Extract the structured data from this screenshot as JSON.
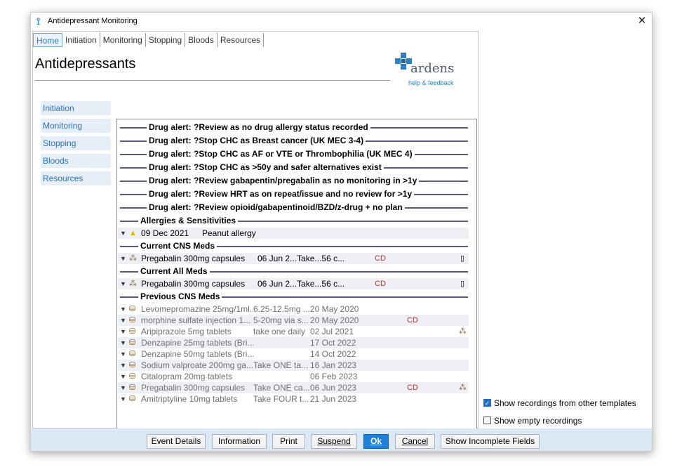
{
  "window": {
    "title": "Antidepressant Monitoring",
    "close_glyph": "✕"
  },
  "tabs": [
    "Home",
    "Initiation",
    "Monitoring",
    "Stopping",
    "Bloods",
    "Resources"
  ],
  "page_title": "Antidepressants",
  "logo": {
    "name": "ardens",
    "help": "help & feedback"
  },
  "sidebar": [
    "Initiation",
    "Monitoring",
    "Stopping",
    "Bloods",
    "Resources"
  ],
  "alerts": [
    "Drug alert: ?Review as no drug allergy status recorded",
    "Drug alert: ?Stop CHC as Breast cancer (UK MEC 3-4)",
    "Drug alert: ?Stop CHC as AF or VTE or Thrombophilia (UK MEC 4)",
    "Drug alert: ?Stop CHC as >50y and safer alternatives exist",
    "Drug alert: ?Review gabapentin/pregabalin as no monitoring in >1y",
    "Drug alert: ?Review HRT as on repeat/issue and no review for >1y",
    "Drug alert: ?Review opioid/gabapentinoid/BZD/z-drug + no plan"
  ],
  "sections": {
    "allergies": "Allergies & Sensitivities",
    "current_cns": "Current CNS Meds",
    "current_all": "Current All Meds",
    "previous_cns": "Previous CNS Meds"
  },
  "allergy_row": {
    "date": "09 Dec 2021",
    "text": "Peanut allergy"
  },
  "current_cns_row": {
    "drug": "Pregabalin 300mg capsules",
    "dose": "06 Jun 2...Take...56 c...",
    "flag": "CD"
  },
  "current_all_row": {
    "drug": "Pregabalin 300mg capsules",
    "dose": "06 Jun 2...Take...56 c...",
    "flag": "CD"
  },
  "previous": [
    {
      "drug": "Levomepromazine 25mg/1ml...",
      "dose": "6.25-12.5mg ...",
      "date": "20 May 2020",
      "flag": ""
    },
    {
      "drug": "morphine sulfate injection 1...",
      "dose": "5-20mg via s...",
      "date": "20 May 2020",
      "flag": "CD"
    },
    {
      "drug": "Aripiprazole 5mg tablets",
      "dose": "take one daily",
      "date": "02 Jul 2021",
      "flag": ""
    },
    {
      "drug": "Denzapine 25mg tablets (Bri...",
      "dose": "",
      "date": "17 Oct 2022",
      "flag": ""
    },
    {
      "drug": "Denzapine 50mg tablets (Bri...",
      "dose": "",
      "date": "14 Oct 2022",
      "flag": ""
    },
    {
      "drug": "Sodium valproate 200mg ga...",
      "dose": "Take ONE ta...",
      "date": "16 Jan 2023",
      "flag": ""
    },
    {
      "drug": "Citalopram 20mg tablets",
      "dose": "",
      "date": "06 Feb 2023",
      "flag": ""
    },
    {
      "drug": "Pregabalin 300mg capsules",
      "dose": "Take ONE ca...",
      "date": "06 Jun 2023",
      "flag": "CD"
    },
    {
      "drug": "Amitriptyline 10mg tablets",
      "dose": "Take FOUR t...",
      "date": "21 Jun 2023",
      "flag": ""
    }
  ],
  "options": {
    "show_other": {
      "label": "Show recordings from other templates",
      "checked": true
    },
    "show_empty": {
      "label": "Show empty recordings",
      "checked": false
    }
  },
  "buttons": {
    "event_details": "Event Details",
    "information": "Information",
    "print": "Print",
    "suspend": "Suspend",
    "ok": "Ok",
    "cancel": "Cancel",
    "show_incomplete": "Show Incomplete Fields"
  },
  "colors": {
    "accent": "#2f7fc6",
    "ok_button": "#1e7fd9",
    "cd_text": "#c0392b",
    "footer": "#dbe9f6"
  },
  "icons": {
    "title": "ardens-logo-icon",
    "warning": "warning-icon",
    "medication": "medication-bottle-icon",
    "pills": "pills-icon"
  }
}
